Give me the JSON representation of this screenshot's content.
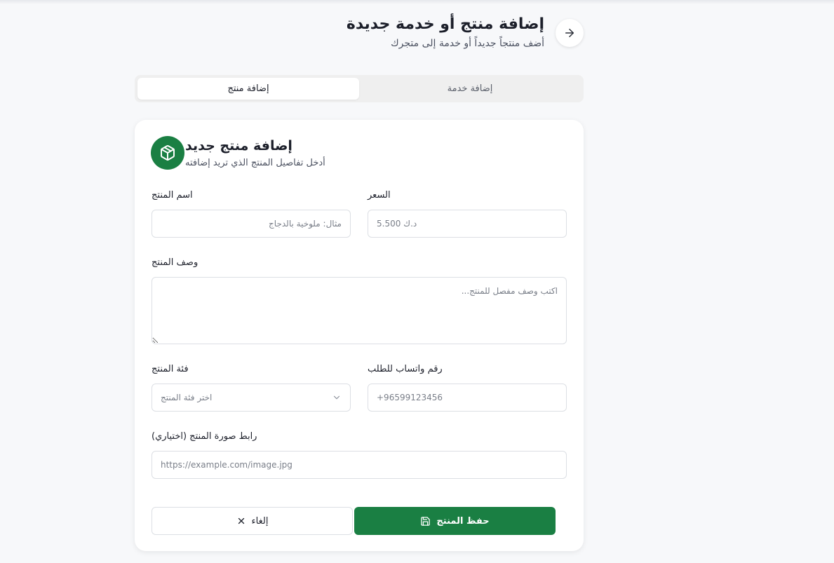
{
  "header": {
    "title": "إضافة منتج أو خدمة جديدة",
    "subtitle": "أضف منتجاً جديداً أو خدمة إلى متجرك"
  },
  "tabs": [
    {
      "label": "إضافة خدمة",
      "active": false
    },
    {
      "label": "إضافة منتج",
      "active": true
    }
  ],
  "card": {
    "title": "إضافة منتج جديد",
    "subtitle": "أدخل تفاصيل المنتج الذي تريد إضافته",
    "icon": "package-icon"
  },
  "form": {
    "name": {
      "label": "اسم المنتج",
      "placeholder": "مثال: ملوخية بالدجاج"
    },
    "price": {
      "label": "السعر",
      "placeholder": "د.ك 5.500"
    },
    "description": {
      "label": "وصف المنتج",
      "placeholder": "اكتب وصف مفصل للمنتج..."
    },
    "category": {
      "label": "فئة المنتج",
      "placeholder": "اختر فئة المنتج"
    },
    "whatsapp": {
      "label": "رقم واتساب للطلب",
      "placeholder": "+96599123456"
    },
    "image_url": {
      "label": "رابط صورة المنتج (اختياري)",
      "placeholder": "https://example.com/image.jpg"
    }
  },
  "actions": {
    "cancel_label": "إلغاء",
    "save_label": "حفظ المنتج"
  },
  "colors": {
    "accent": "#1a7f43",
    "background": "#f7f8fa"
  }
}
